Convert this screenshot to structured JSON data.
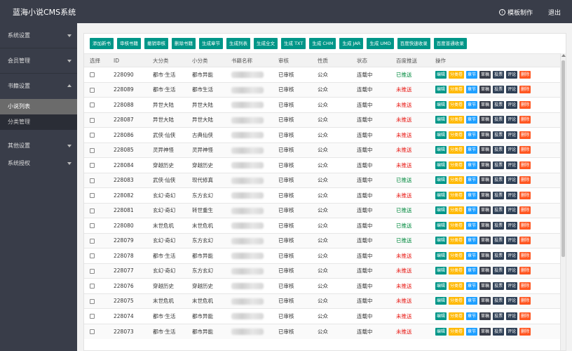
{
  "header": {
    "brand": "蓝海小说CMS系统",
    "template_label": "模板制作",
    "logout_label": "退出"
  },
  "sidebar": {
    "groups": [
      {
        "label": "系统设置"
      },
      {
        "label": "会员管理"
      },
      {
        "label": "书籍设置"
      }
    ],
    "subitems": [
      {
        "label": "小说列表"
      },
      {
        "label": "分类管理"
      }
    ],
    "more": [
      {
        "label": "其他设置"
      },
      {
        "label": "系统授权"
      }
    ]
  },
  "toolbar": {
    "buttons": [
      "添加新书",
      "审核书籍",
      "撤销审核",
      "删除书籍",
      "生成章节",
      "生成列表",
      "生成全文",
      "生成 TXT",
      "生成 CHM",
      "生成 JAR",
      "生成 UMD",
      "百度快速收录",
      "百度普通收录"
    ]
  },
  "table": {
    "headers": [
      "选择",
      "ID",
      "大分类",
      "小分类",
      "书籍名称",
      "审核",
      "性质",
      "状态",
      "百度推送",
      "操作"
    ],
    "op_labels": [
      "编辑",
      "分类卷",
      "章节",
      "草稿",
      "投票",
      "评论",
      "删除"
    ],
    "rows": [
      {
        "id": "228090",
        "big": "都市·生活",
        "small": "都市异能",
        "audit": "已审核",
        "nature": "公众",
        "status": "连载中",
        "push": "已推送",
        "pushed": true
      },
      {
        "id": "228089",
        "big": "都市·生活",
        "small": "都市生活",
        "audit": "已审核",
        "nature": "公众",
        "status": "连载中",
        "push": "未推送",
        "pushed": false
      },
      {
        "id": "228088",
        "big": "异世大陆",
        "small": "异世大陆",
        "audit": "已审核",
        "nature": "公众",
        "status": "连载中",
        "push": "未推送",
        "pushed": false
      },
      {
        "id": "228087",
        "big": "异世大陆",
        "small": "异世大陆",
        "audit": "已审核",
        "nature": "公众",
        "status": "连载中",
        "push": "未推送",
        "pushed": false
      },
      {
        "id": "228086",
        "big": "武侠·仙侠",
        "small": "古典仙侠",
        "audit": "已审核",
        "nature": "公众",
        "status": "连载中",
        "push": "未推送",
        "pushed": false
      },
      {
        "id": "228085",
        "big": "灵异神怪",
        "small": "灵异神怪",
        "audit": "已审核",
        "nature": "公众",
        "status": "连载中",
        "push": "未推送",
        "pushed": false
      },
      {
        "id": "228084",
        "big": "穿越历史",
        "small": "穿越历史",
        "audit": "已审核",
        "nature": "公众",
        "status": "连载中",
        "push": "未推送",
        "pushed": false
      },
      {
        "id": "228083",
        "big": "武侠·仙侠",
        "small": "现代修真",
        "audit": "已审核",
        "nature": "公众",
        "status": "连载中",
        "push": "已推送",
        "pushed": true
      },
      {
        "id": "228082",
        "big": "玄幻·奇幻",
        "small": "东方玄幻",
        "audit": "已审核",
        "nature": "公众",
        "status": "连载中",
        "push": "未推送",
        "pushed": false
      },
      {
        "id": "228081",
        "big": "玄幻·奇幻",
        "small": "转世重生",
        "audit": "已审核",
        "nature": "公众",
        "status": "连载中",
        "push": "已推送",
        "pushed": true
      },
      {
        "id": "228080",
        "big": "末世危机",
        "small": "末世危机",
        "audit": "已审核",
        "nature": "公众",
        "status": "连载中",
        "push": "已推送",
        "pushed": true
      },
      {
        "id": "228079",
        "big": "玄幻·奇幻",
        "small": "东方玄幻",
        "audit": "已审核",
        "nature": "公众",
        "status": "连载中",
        "push": "已推送",
        "pushed": true
      },
      {
        "id": "228078",
        "big": "都市·生活",
        "small": "都市异能",
        "audit": "已审核",
        "nature": "公众",
        "status": "连载中",
        "push": "未推送",
        "pushed": false
      },
      {
        "id": "228077",
        "big": "玄幻·奇幻",
        "small": "东方玄幻",
        "audit": "已审核",
        "nature": "公众",
        "status": "连载中",
        "push": "未推送",
        "pushed": false
      },
      {
        "id": "228076",
        "big": "穿越历史",
        "small": "穿越历史",
        "audit": "已审核",
        "nature": "公众",
        "status": "连载中",
        "push": "未推送",
        "pushed": false
      },
      {
        "id": "228075",
        "big": "末世危机",
        "small": "末世危机",
        "audit": "已审核",
        "nature": "公众",
        "status": "连载中",
        "push": "未推送",
        "pushed": false
      },
      {
        "id": "228074",
        "big": "都市·生活",
        "small": "都市异能",
        "audit": "已审核",
        "nature": "公众",
        "status": "连载中",
        "push": "未推送",
        "pushed": false
      },
      {
        "id": "228073",
        "big": "都市·生活",
        "small": "都市异能",
        "audit": "已审核",
        "nature": "公众",
        "status": "连载中",
        "push": "未推送",
        "pushed": false
      }
    ]
  }
}
